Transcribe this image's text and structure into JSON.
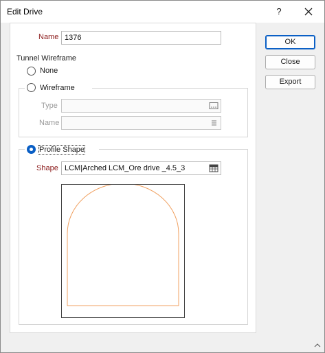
{
  "window": {
    "title": "Edit Drive",
    "help_label": "?"
  },
  "form": {
    "name_label": "Name",
    "name_value": "1376",
    "tunnel_group_title": "Tunnel Wireframe",
    "none_label": "None",
    "wireframe_label": "Wireframe",
    "type_label": "Type",
    "type_value": "",
    "wf_name_label": "Name",
    "wf_name_value": "",
    "profile_label": "Profile Shape",
    "shape_label": "Shape",
    "shape_value": "LCM|Arched LCM_Ore drive _4.5_3",
    "selected_option": "Profile Shape"
  },
  "buttons": {
    "ok": "OK",
    "close": "Close",
    "export": "Export"
  },
  "colors": {
    "accent": "#0a5fc5",
    "required_label": "#8b1a1a",
    "profile_outline": "#f0a060"
  },
  "icons": {
    "close": "close-icon",
    "browse": "browse-icon",
    "list": "list-icon",
    "table": "table-icon",
    "grip": "resize-grip-icon"
  }
}
